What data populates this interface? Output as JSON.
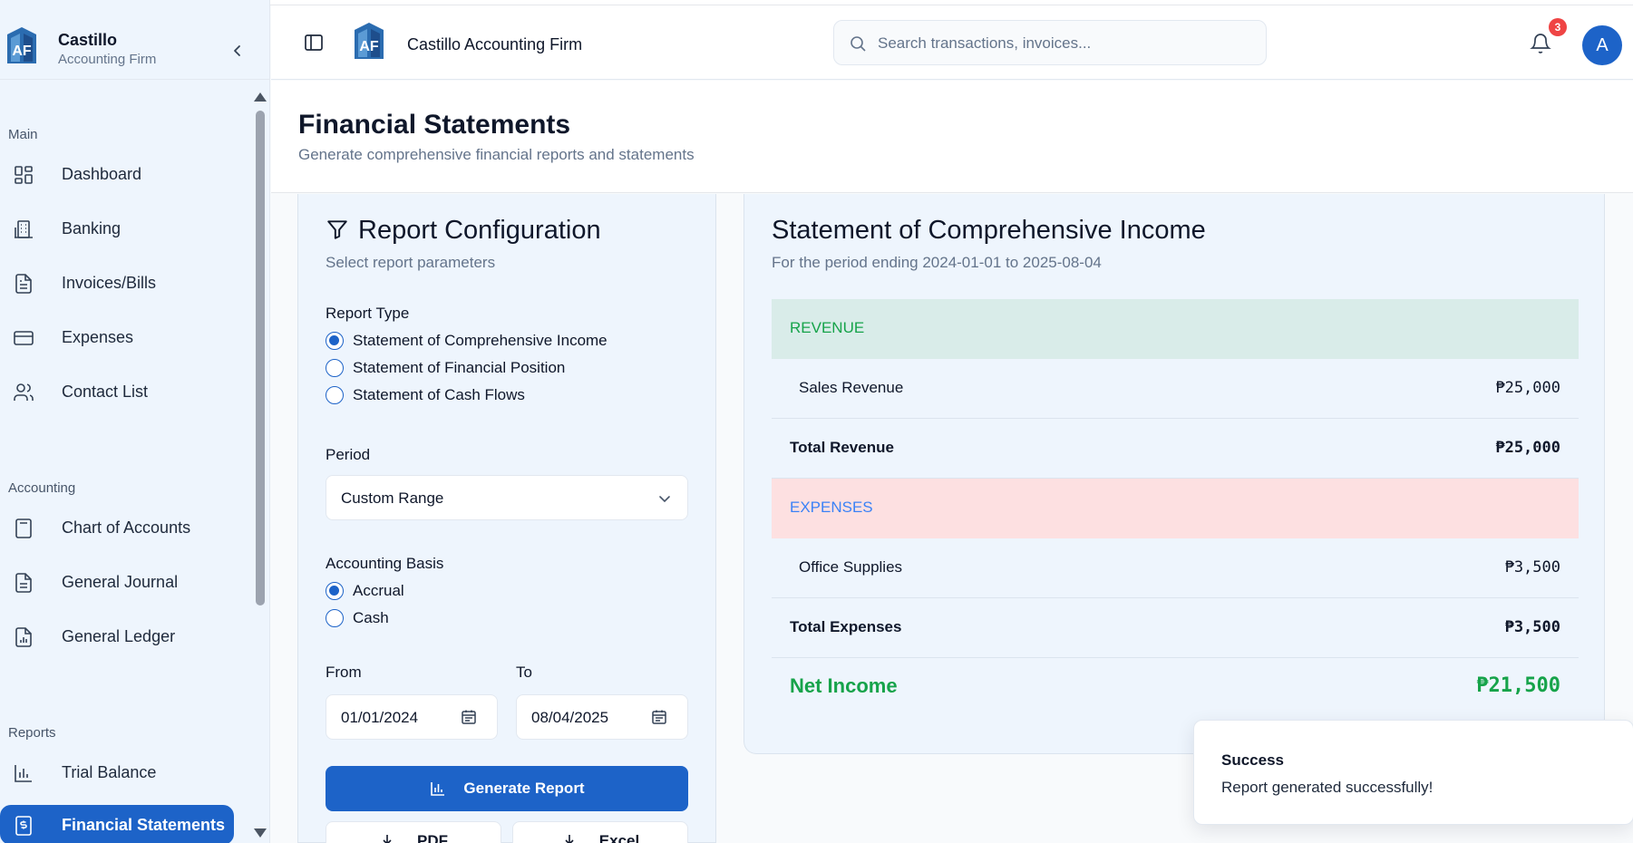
{
  "brand": {
    "name": "Castillo",
    "subtitle": "Accounting Firm",
    "firm_name": "Castillo Accounting Firm"
  },
  "search": {
    "placeholder": "Search transactions, invoices..."
  },
  "notifications": {
    "count": "3"
  },
  "user": {
    "initial": "A"
  },
  "sidebar": {
    "sections": [
      {
        "label": "Main"
      },
      {
        "label": "Accounting"
      },
      {
        "label": "Reports"
      }
    ],
    "items": [
      {
        "label": "Dashboard",
        "icon": "dashboard-icon"
      },
      {
        "label": "Banking",
        "icon": "bank-icon"
      },
      {
        "label": "Invoices/Bills",
        "icon": "document-icon"
      },
      {
        "label": "Expenses",
        "icon": "credit-card-icon"
      },
      {
        "label": "Contact List",
        "icon": "users-icon"
      },
      {
        "label": "Chart of Accounts",
        "icon": "calculator-icon"
      },
      {
        "label": "General Journal",
        "icon": "journal-icon"
      },
      {
        "label": "General Ledger",
        "icon": "ledger-icon"
      },
      {
        "label": "Trial Balance",
        "icon": "bar-chart-icon"
      },
      {
        "label": "Financial Statements",
        "icon": "dollar-document-icon",
        "active": true
      }
    ]
  },
  "page": {
    "title": "Financial Statements",
    "description": "Generate comprehensive financial reports and statements"
  },
  "config": {
    "title": "Report Configuration",
    "subtitle": "Select report parameters",
    "report_type_label": "Report Type",
    "report_types": [
      {
        "label": "Statement of Comprehensive Income",
        "selected": true
      },
      {
        "label": "Statement of Financial Position",
        "selected": false
      },
      {
        "label": "Statement of Cash Flows",
        "selected": false
      }
    ],
    "period_label": "Period",
    "period_value": "Custom Range",
    "basis_label": "Accounting Basis",
    "basis_options": [
      {
        "label": "Accrual",
        "selected": true
      },
      {
        "label": "Cash",
        "selected": false
      }
    ],
    "from_label": "From",
    "from_value": "01/01/2024",
    "to_label": "To",
    "to_value": "08/04/2025",
    "generate_label": "Generate Report",
    "pdf_label": "PDF",
    "excel_label": "Excel"
  },
  "statement": {
    "title": "Statement of Comprehensive Income",
    "subtitle": "For the period ending 2024-01-01 to 2025-08-04",
    "revenue_header": "REVENUE",
    "revenue_items": [
      {
        "label": "Sales Revenue",
        "value": "₱25,000"
      }
    ],
    "total_revenue_label": "Total Revenue",
    "total_revenue_value": "₱25,000",
    "expenses_header": "EXPENSES",
    "expense_items": [
      {
        "label": "Office Supplies",
        "value": "₱3,500"
      }
    ],
    "total_expenses_label": "Total Expenses",
    "total_expenses_value": "₱3,500",
    "net_income_label": "Net Income",
    "net_income_value": "₱21,500"
  },
  "toast": {
    "title": "Success",
    "message": "Report generated successfully!"
  },
  "colors": {
    "primary": "#1d63c8",
    "positive": "#16a34a",
    "revenue_bg": "#d9ece9",
    "expense_bg": "#fde0e1",
    "sidebar_bg": "#eef5fd"
  }
}
